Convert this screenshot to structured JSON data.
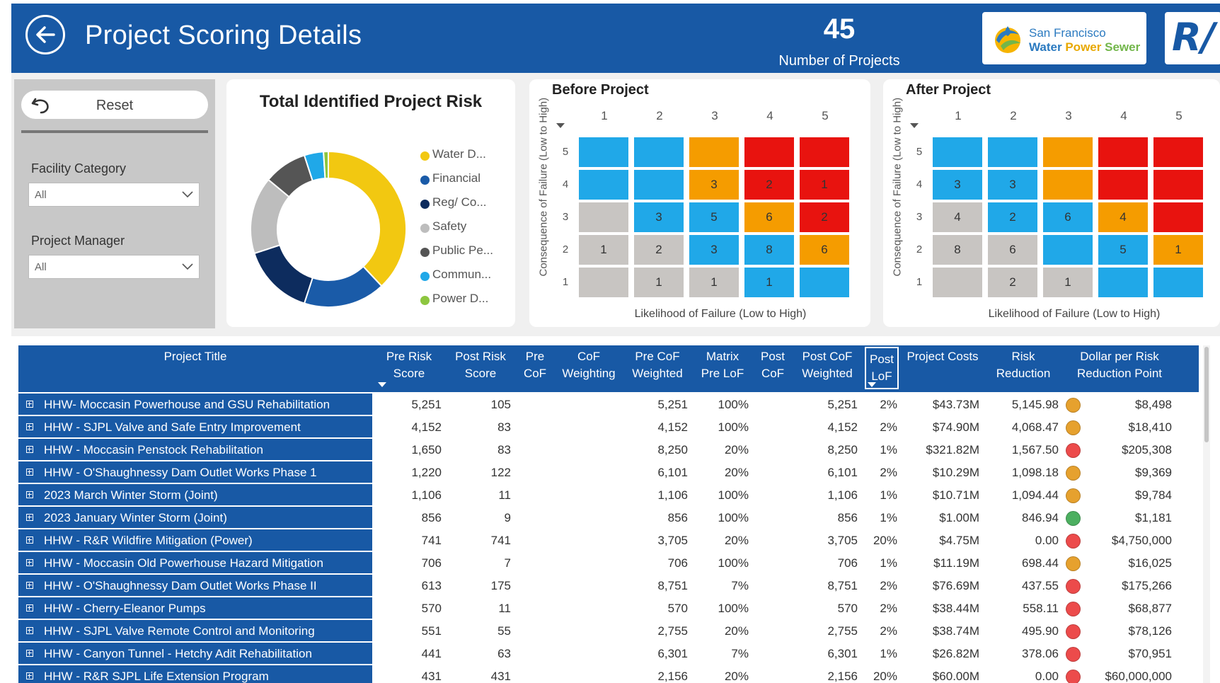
{
  "header": {
    "title": "Project Scoring Details",
    "kpi_value": "45",
    "kpi_label": "Number of Projects",
    "logo_line1": "San Francisco",
    "logo_water": "Water",
    "logo_power": "Power",
    "logo_sewer": "Sewer",
    "rv_logo": "R/"
  },
  "filters": {
    "reset_label": "Reset",
    "facility_label": "Facility Category",
    "facility_value": "All",
    "manager_label": "Project Manager",
    "manager_value": "All"
  },
  "donut": {
    "title": "Total Identified Project Risk",
    "legend": [
      {
        "label": "Water D...",
        "color": "#f2c811"
      },
      {
        "label": "Financial",
        "color": "#1a5ba8"
      },
      {
        "label": "Reg/ Co...",
        "color": "#0d2c5e"
      },
      {
        "label": "Safety",
        "color": "#bdbdbd"
      },
      {
        "label": "Public Pe...",
        "color": "#555555"
      },
      {
        "label": "Commun...",
        "color": "#20a8e8"
      },
      {
        "label": "Power D...",
        "color": "#8dc63f"
      }
    ],
    "slices": [
      {
        "name": "Water D...",
        "value": 38,
        "color": "#f2c811"
      },
      {
        "name": "Financial",
        "value": 17,
        "color": "#1a5ba8"
      },
      {
        "name": "Reg/ Co...",
        "value": 15,
        "color": "#0d2c5e"
      },
      {
        "name": "Safety",
        "value": 16,
        "color": "#bdbdbd"
      },
      {
        "name": "Public Pe...",
        "value": 9,
        "color": "#555555"
      },
      {
        "name": "Commun...",
        "value": 4,
        "color": "#20a8e8"
      },
      {
        "name": "Power D...",
        "value": 1,
        "color": "#8dc63f"
      }
    ]
  },
  "colors": {
    "header_blue": "#1859a5",
    "blue": "#20a8e8",
    "orange": "#f59c00",
    "red": "#e8130f",
    "gray": "#c8c5c2",
    "status_orange": "#e6a12e",
    "status_red": "#ec4b4b",
    "status_green": "#4caf60"
  },
  "before_matrix": {
    "title": "Before Project",
    "ylabel": "Consequence of Failure (Low to High)",
    "xlabel": "Likelihood of Failure (Low to High)",
    "cols": [
      "1",
      "2",
      "3",
      "4",
      "5"
    ],
    "rows": [
      "5",
      "4",
      "3",
      "2",
      "1"
    ],
    "cells": [
      [
        {
          "c": "blue",
          "v": ""
        },
        {
          "c": "blue",
          "v": ""
        },
        {
          "c": "orange",
          "v": ""
        },
        {
          "c": "red",
          "v": ""
        },
        {
          "c": "red",
          "v": ""
        }
      ],
      [
        {
          "c": "blue",
          "v": ""
        },
        {
          "c": "blue",
          "v": ""
        },
        {
          "c": "orange",
          "v": "3"
        },
        {
          "c": "red",
          "v": "2"
        },
        {
          "c": "red",
          "v": "1"
        }
      ],
      [
        {
          "c": "gray",
          "v": ""
        },
        {
          "c": "blue",
          "v": "3"
        },
        {
          "c": "blue",
          "v": "5"
        },
        {
          "c": "orange",
          "v": "6"
        },
        {
          "c": "red",
          "v": "2"
        }
      ],
      [
        {
          "c": "gray",
          "v": "1"
        },
        {
          "c": "gray",
          "v": "2"
        },
        {
          "c": "blue",
          "v": "3"
        },
        {
          "c": "blue",
          "v": "8"
        },
        {
          "c": "orange",
          "v": "6"
        }
      ],
      [
        {
          "c": "gray",
          "v": ""
        },
        {
          "c": "gray",
          "v": "1"
        },
        {
          "c": "gray",
          "v": "1"
        },
        {
          "c": "blue",
          "v": "1"
        },
        {
          "c": "blue",
          "v": ""
        }
      ]
    ]
  },
  "after_matrix": {
    "title": "After Project",
    "ylabel": "Consequence of Failure (Low to High)",
    "xlabel": "Likelihood of Failure (Low to High)",
    "cols": [
      "1",
      "2",
      "3",
      "4",
      "5"
    ],
    "rows": [
      "5",
      "4",
      "3",
      "2",
      "1"
    ],
    "cells": [
      [
        {
          "c": "blue",
          "v": ""
        },
        {
          "c": "blue",
          "v": ""
        },
        {
          "c": "orange",
          "v": ""
        },
        {
          "c": "red",
          "v": ""
        },
        {
          "c": "red",
          "v": ""
        }
      ],
      [
        {
          "c": "blue",
          "v": "3"
        },
        {
          "c": "blue",
          "v": "3"
        },
        {
          "c": "orange",
          "v": ""
        },
        {
          "c": "red",
          "v": ""
        },
        {
          "c": "red",
          "v": ""
        }
      ],
      [
        {
          "c": "gray",
          "v": "4"
        },
        {
          "c": "blue",
          "v": "2"
        },
        {
          "c": "blue",
          "v": "6"
        },
        {
          "c": "orange",
          "v": "4"
        },
        {
          "c": "red",
          "v": ""
        }
      ],
      [
        {
          "c": "gray",
          "v": "8"
        },
        {
          "c": "gray",
          "v": "6"
        },
        {
          "c": "blue",
          "v": ""
        },
        {
          "c": "blue",
          "v": "5"
        },
        {
          "c": "orange",
          "v": "1"
        }
      ],
      [
        {
          "c": "gray",
          "v": ""
        },
        {
          "c": "gray",
          "v": "2"
        },
        {
          "c": "gray",
          "v": "1"
        },
        {
          "c": "blue",
          "v": ""
        },
        {
          "c": "blue",
          "v": ""
        }
      ]
    ]
  },
  "table": {
    "headers": [
      [
        "Project Title"
      ],
      [
        "Pre Risk",
        "Score"
      ],
      [
        "Post Risk",
        "Score"
      ],
      [
        "Pre",
        "CoF"
      ],
      [
        "CoF",
        "Weighting"
      ],
      [
        "Pre CoF",
        "Weighted"
      ],
      [
        "Matrix",
        "Pre LoF"
      ],
      [
        "Post",
        "CoF"
      ],
      [
        "Post CoF",
        "Weighted"
      ],
      [
        "Post",
        "LoF"
      ],
      [
        "Project Costs"
      ],
      [
        "Risk",
        "Reduction"
      ],
      [
        "Dollar per Risk",
        "Reduction Point"
      ]
    ],
    "rows": [
      {
        "title": "HHW- Moccasin Powerhouse and GSU Rehabilitation",
        "pre_risk": "5,251",
        "post_risk": "105",
        "pre_cof": "",
        "cof_w": "",
        "pre_cof_w": "5,251",
        "matrix_pre_lof": "100%",
        "post_cof": "",
        "post_cof_w": "5,251",
        "post_lof": "2%",
        "costs": "$43.73M",
        "risk_red": "5,145.98",
        "status": "orange",
        "dollar": "$8,498"
      },
      {
        "title": "HHW - SJPL Valve and Safe Entry Improvement",
        "pre_risk": "4,152",
        "post_risk": "83",
        "pre_cof": "",
        "cof_w": "",
        "pre_cof_w": "4,152",
        "matrix_pre_lof": "100%",
        "post_cof": "",
        "post_cof_w": "4,152",
        "post_lof": "2%",
        "costs": "$74.90M",
        "risk_red": "4,068.47",
        "status": "orange",
        "dollar": "$18,410"
      },
      {
        "title": "HHW - Moccasin Penstock Rehabilitation",
        "pre_risk": "1,650",
        "post_risk": "83",
        "pre_cof": "",
        "cof_w": "",
        "pre_cof_w": "8,250",
        "matrix_pre_lof": "20%",
        "post_cof": "",
        "post_cof_w": "8,250",
        "post_lof": "1%",
        "costs": "$321.82M",
        "risk_red": "1,567.50",
        "status": "red",
        "dollar": "$205,308"
      },
      {
        "title": "HHW - O'Shaughnessy Dam Outlet Works Phase 1",
        "pre_risk": "1,220",
        "post_risk": "122",
        "pre_cof": "",
        "cof_w": "",
        "pre_cof_w": "6,101",
        "matrix_pre_lof": "20%",
        "post_cof": "",
        "post_cof_w": "6,101",
        "post_lof": "2%",
        "costs": "$10.29M",
        "risk_red": "1,098.18",
        "status": "orange",
        "dollar": "$9,369"
      },
      {
        "title": "2023 March Winter Storm (Joint)",
        "pre_risk": "1,106",
        "post_risk": "11",
        "pre_cof": "",
        "cof_w": "",
        "pre_cof_w": "1,106",
        "matrix_pre_lof": "100%",
        "post_cof": "",
        "post_cof_w": "1,106",
        "post_lof": "1%",
        "costs": "$10.71M",
        "risk_red": "1,094.44",
        "status": "orange",
        "dollar": "$9,784"
      },
      {
        "title": "2023 January Winter Storm (Joint)",
        "pre_risk": "856",
        "post_risk": "9",
        "pre_cof": "",
        "cof_w": "",
        "pre_cof_w": "856",
        "matrix_pre_lof": "100%",
        "post_cof": "",
        "post_cof_w": "856",
        "post_lof": "1%",
        "costs": "$1.00M",
        "risk_red": "846.94",
        "status": "green",
        "dollar": "$1,181"
      },
      {
        "title": "HHW - R&R Wildfire Mitigation (Power)",
        "pre_risk": "741",
        "post_risk": "741",
        "pre_cof": "",
        "cof_w": "",
        "pre_cof_w": "3,705",
        "matrix_pre_lof": "20%",
        "post_cof": "",
        "post_cof_w": "3,705",
        "post_lof": "20%",
        "costs": "$4.75M",
        "risk_red": "0.00",
        "status": "red",
        "dollar": "$4,750,000"
      },
      {
        "title": "HHW - Moccasin Old Powerhouse Hazard Mitigation",
        "pre_risk": "706",
        "post_risk": "7",
        "pre_cof": "",
        "cof_w": "",
        "pre_cof_w": "706",
        "matrix_pre_lof": "100%",
        "post_cof": "",
        "post_cof_w": "706",
        "post_lof": "1%",
        "costs": "$11.19M",
        "risk_red": "698.44",
        "status": "orange",
        "dollar": "$16,025"
      },
      {
        "title": "HHW - O'Shaughnessy Dam Outlet Works Phase II",
        "pre_risk": "613",
        "post_risk": "175",
        "pre_cof": "",
        "cof_w": "",
        "pre_cof_w": "8,751",
        "matrix_pre_lof": "7%",
        "post_cof": "",
        "post_cof_w": "8,751",
        "post_lof": "2%",
        "costs": "$76.69M",
        "risk_red": "437.55",
        "status": "red",
        "dollar": "$175,266"
      },
      {
        "title": "HHW - Cherry-Eleanor Pumps",
        "pre_risk": "570",
        "post_risk": "11",
        "pre_cof": "",
        "cof_w": "",
        "pre_cof_w": "570",
        "matrix_pre_lof": "100%",
        "post_cof": "",
        "post_cof_w": "570",
        "post_lof": "2%",
        "costs": "$38.44M",
        "risk_red": "558.11",
        "status": "red",
        "dollar": "$68,877"
      },
      {
        "title": "HHW - SJPL Valve Remote Control and Monitoring",
        "pre_risk": "551",
        "post_risk": "55",
        "pre_cof": "",
        "cof_w": "",
        "pre_cof_w": "2,755",
        "matrix_pre_lof": "20%",
        "post_cof": "",
        "post_cof_w": "2,755",
        "post_lof": "2%",
        "costs": "$38.74M",
        "risk_red": "495.90",
        "status": "red",
        "dollar": "$78,126"
      },
      {
        "title": "HHW - Canyon Tunnel - Hetchy Adit Rehabilitation",
        "pre_risk": "441",
        "post_risk": "63",
        "pre_cof": "",
        "cof_w": "",
        "pre_cof_w": "6,301",
        "matrix_pre_lof": "7%",
        "post_cof": "",
        "post_cof_w": "6,301",
        "post_lof": "1%",
        "costs": "$26.82M",
        "risk_red": "378.06",
        "status": "red",
        "dollar": "$70,951"
      },
      {
        "title": "HHW - R&R SJPL Life Extension Program",
        "pre_risk": "431",
        "post_risk": "431",
        "pre_cof": "",
        "cof_w": "",
        "pre_cof_w": "2,156",
        "matrix_pre_lof": "20%",
        "post_cof": "",
        "post_cof_w": "2,156",
        "post_lof": "20%",
        "costs": "$60.00M",
        "risk_red": "0.00",
        "status": "red",
        "dollar": "$60,000,000"
      }
    ]
  }
}
